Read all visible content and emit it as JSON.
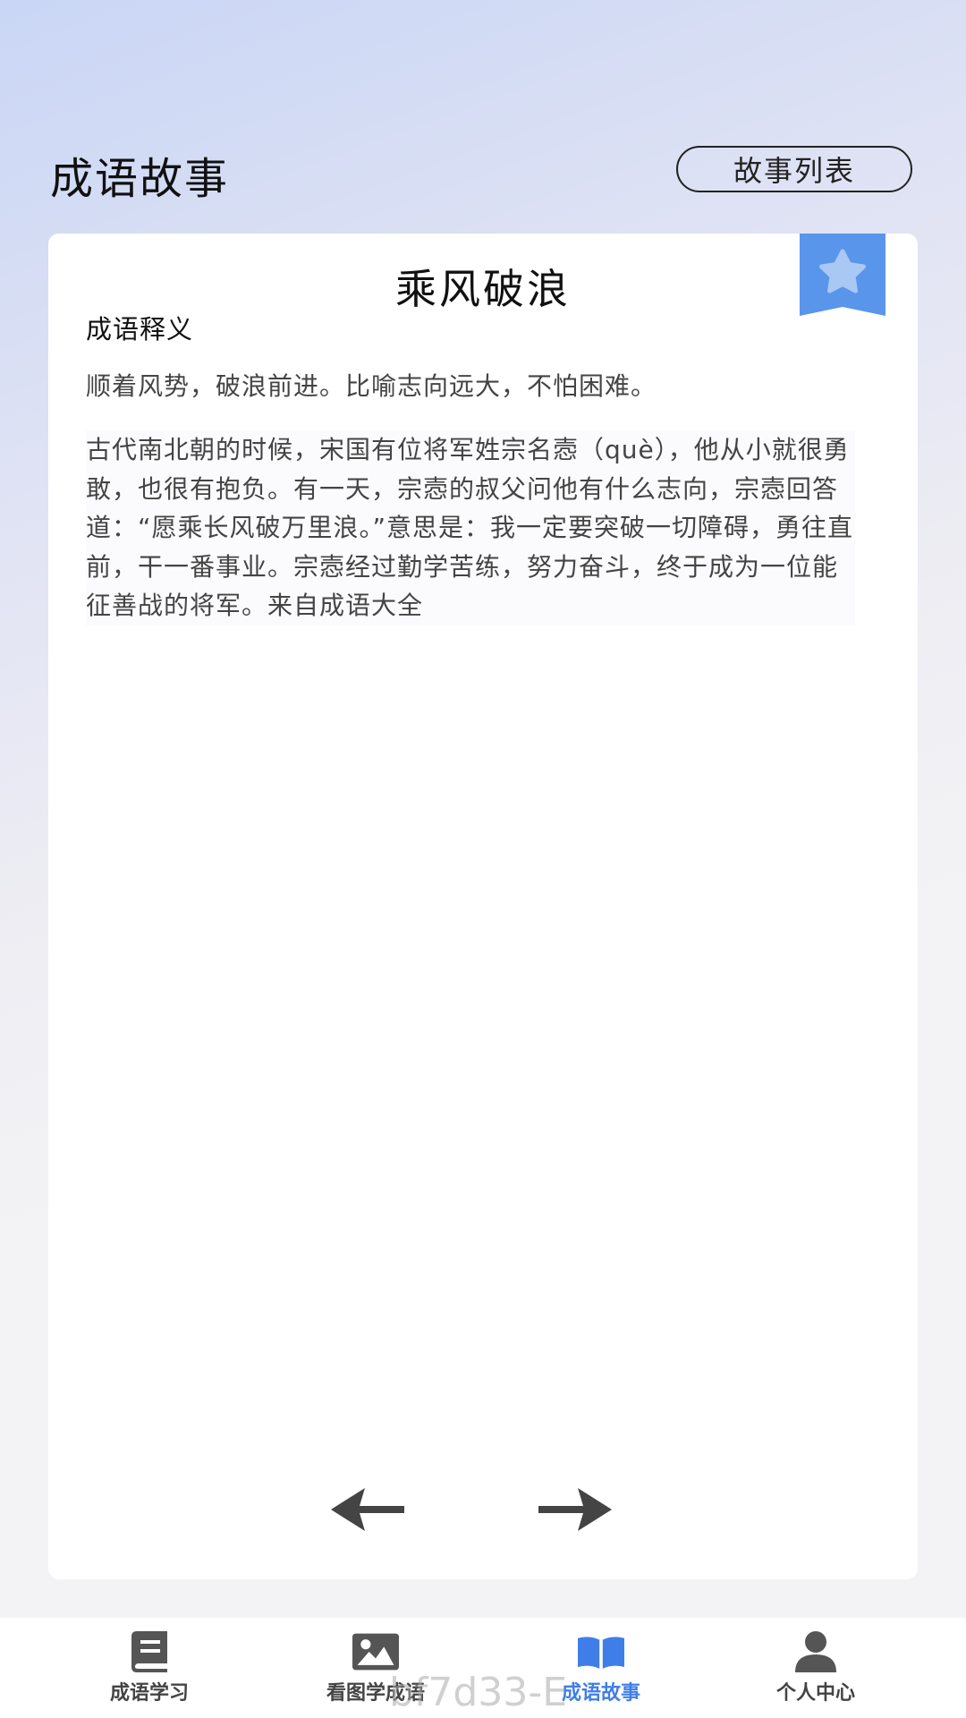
{
  "header": {
    "title": "成语故事",
    "story_list_button": "故事列表"
  },
  "card": {
    "idiom": "乘风破浪",
    "bookmark_icon": "star-bookmark-icon",
    "meaning_heading": "成语释义",
    "meaning": "顺着风势，破浪前进。比喻志向远大，不怕困难。",
    "story": "古代南北朝的时候，宋国有位将军姓宗名悫（què），他从小就很勇敢，也很有抱负。有一天，宗悫的叔父问他有什么志向，宗悫回答道：“愿乘长风破万里浪。”意思是：我一定要突破一切障碍，勇往直前，干一番事业。宗悫经过勤学苦练，努力奋斗，终于成为一位能征善战的将军。来自成语大全",
    "prev_icon": "arrow-left-icon",
    "next_icon": "arrow-right-icon"
  },
  "nav": {
    "items": [
      {
        "label": "成语学习",
        "icon": "book-icon",
        "active": false
      },
      {
        "label": "看图学成语",
        "icon": "image-icon",
        "active": false
      },
      {
        "label": "成语故事",
        "icon": "open-book-icon",
        "active": true
      },
      {
        "label": "个人中心",
        "icon": "user-icon",
        "active": false
      }
    ]
  },
  "watermark": "bf7d33-E",
  "colors": {
    "accent": "#3f7ee8",
    "bookmark": "#5a95ec",
    "bookmark_star": "#a9c8f3"
  }
}
